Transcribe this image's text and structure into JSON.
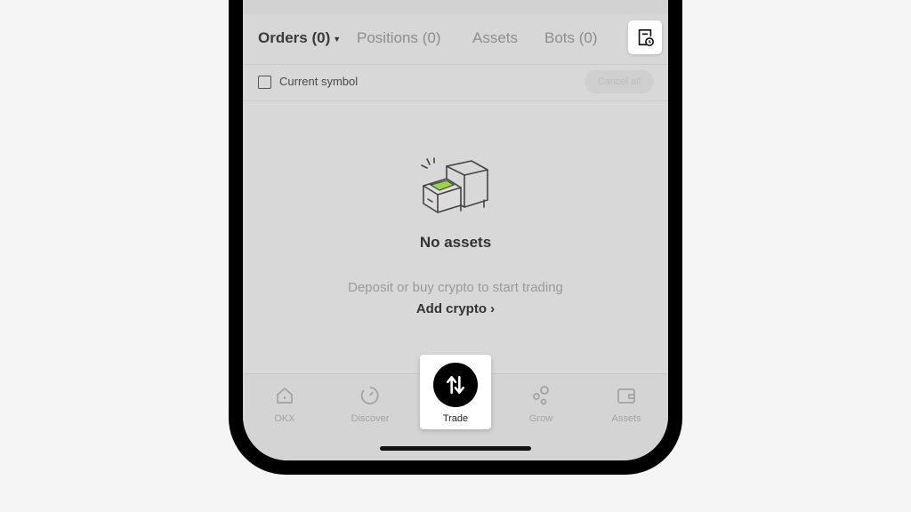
{
  "tabs": {
    "orders": "Orders (0)",
    "positions": "Positions (0)",
    "assets": "Assets",
    "bots": "Bots (0)"
  },
  "filter": {
    "current_symbol": "Current symbol",
    "cancel_all": "Cancel all"
  },
  "empty_state": {
    "title": "No assets",
    "description": "Deposit or buy crypto to start trading",
    "action": "Add crypto",
    "action_chevron": "›"
  },
  "nav": {
    "okx": "OKX",
    "discover": "Discover",
    "trade": "Trade",
    "grow": "Grow",
    "assets": "Assets"
  },
  "icons": {
    "history": "history-clock-icon",
    "trade": "arrows-swap-icon",
    "home": "home-icon",
    "discover": "discover-icon",
    "grow": "grow-icon",
    "wallet": "wallet-icon",
    "empty": "empty-drawer-icon"
  },
  "colors": {
    "accent_green": "#9ad34a",
    "highlight_bg": "#ffffff",
    "dim_overlay": "#d8d8d8"
  }
}
